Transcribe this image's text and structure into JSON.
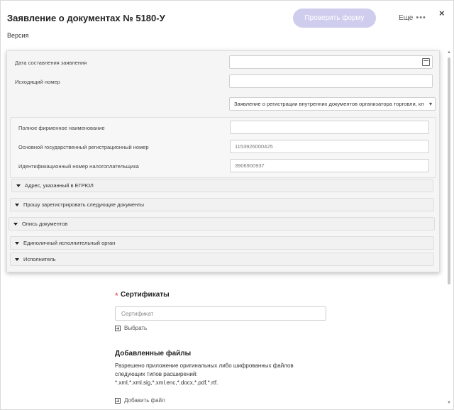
{
  "header": {
    "title": "Заявление о документах № 5180-У",
    "version_label": "Версия",
    "check_button": "Проверить форму",
    "more_label": "Еще",
    "more_dots": "•••",
    "close_symbol": "×"
  },
  "form": {
    "date_label": "Дата составления заявления",
    "date_value": "",
    "outgoing_label": "Исходящий номер",
    "outgoing_value": "",
    "application_type": "Заявление о регистрации внутренних документов организатора торговли, кл",
    "full_name_label": "Полное фирменное наименование",
    "full_name_value": "",
    "ogrn_label": "Основной государственный регистрационный номер",
    "ogrn_value": "1153926000425",
    "inn_label": "Идентификационный номер налогоплательщика",
    "inn_value": "3906900937",
    "sections": [
      "Адрес, указанный в ЕГРЮЛ",
      "Прошу зарегистрировать следующие документы",
      "Опись документов",
      "Единоличный исполнительный орган",
      "Исполнитель"
    ]
  },
  "certificates": {
    "required_mark": "*",
    "title": "Сертификаты",
    "placeholder": "Сертификат",
    "select_label": "Выбрать"
  },
  "files": {
    "title": "Добавленные файлы",
    "desc_lines": [
      "Разрешено приложение оригинальных либо шифрованных файлов",
      "следующих типов расширений:",
      "*.xml,*.xml.sig,*.xml.enc,*.docx,*.pdf,*.rtf."
    ],
    "add_label": "Добавить файл"
  },
  "colors": {
    "check_button_bg": "#cfcdee",
    "required": "#e53935"
  },
  "icons": [
    "calendar-icon",
    "dropdown-arrow-icon",
    "collapse-triangle-icon",
    "plus-box-icon",
    "close-icon",
    "more-dots-icon"
  ]
}
